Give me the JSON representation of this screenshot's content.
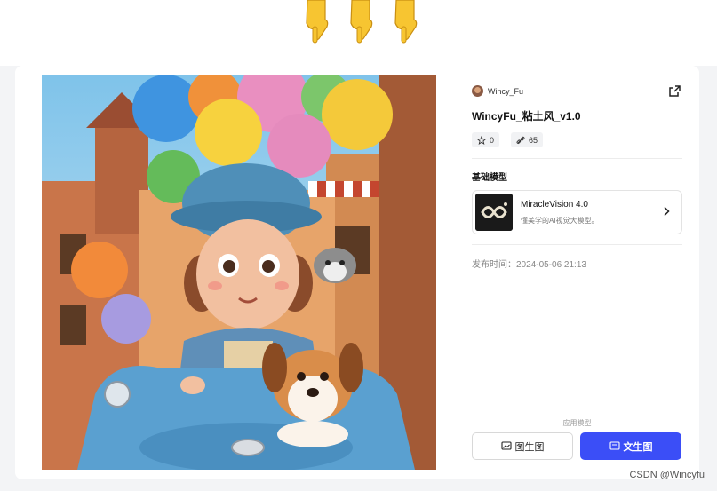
{
  "header": {
    "decoration": [
      "pointing-down-hand-icon",
      "pointing-down-hand-icon",
      "pointing-down-hand-icon"
    ]
  },
  "model": {
    "author": "Wincy_Fu",
    "title": "WincyFu_粘土风_v1.0",
    "stars": "0",
    "uses": "65",
    "base_model_label": "基础模型",
    "base_model": {
      "name": "MiracleVision 4.0",
      "description": "懂美学的AI视觉大模型。"
    },
    "published_label": "发布时间：",
    "published_date": "2024-05-06 21:13",
    "apply_label": "应用模型",
    "buttons": {
      "image_to_image": "图生图",
      "text_to_image": "文生图"
    }
  },
  "colors": {
    "accent": "#3b4ef7",
    "card": "#ffffff",
    "page_bg": "#f3f4f6"
  },
  "watermark": "CSDN @Wincyfu"
}
